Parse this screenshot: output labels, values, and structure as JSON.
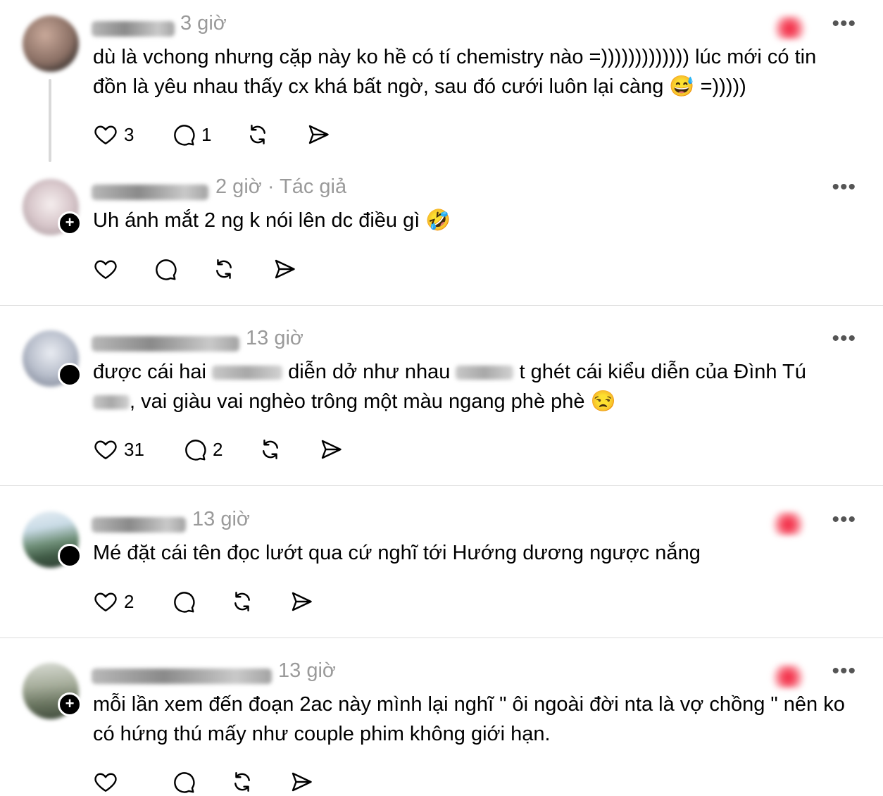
{
  "comments": [
    {
      "time": "3 giờ",
      "text": "dù là vchong nhưng cặp này ko hề có tí chemistry nào =))))))))))))) lúc mới có tin đồn là yêu nhau thấy cx khá bất ngờ, sau đó cưới luôn lại càng 😅 =)))))",
      "likes": "3",
      "replies": "1"
    },
    {
      "time": "2 giờ · Tác giả",
      "text": "Uh ánh mắt 2 ng k nói lên dc điều gì 🤣",
      "likes": "",
      "replies": ""
    },
    {
      "time": "13 giờ",
      "text_part1": "được cái hai",
      "text_part2": "diễn dở như nhau",
      "text_part3": "t ghét cái kiểu diễn của Đình Tú",
      "text_part4": ", vai giàu vai nghèo trông một màu ngang phè phè 😒",
      "likes": "31",
      "replies": "2"
    },
    {
      "time": "13 giờ",
      "text": "Mé đặt cái tên đọc lướt qua cứ nghĩ tới Hướng dương ngược nắng",
      "likes": "2",
      "replies": ""
    },
    {
      "time": "13 giờ",
      "text": "mỗi lần xem đến đoạn 2ac này mình lại nghĩ \" ôi ngoài đời nta là vợ chồng \" nên ko có hứng thú mấy như couple phim không giới hạn.",
      "likes": "",
      "replies": ""
    }
  ],
  "ui": {
    "more_label": "•••",
    "plus_badge": "+"
  }
}
